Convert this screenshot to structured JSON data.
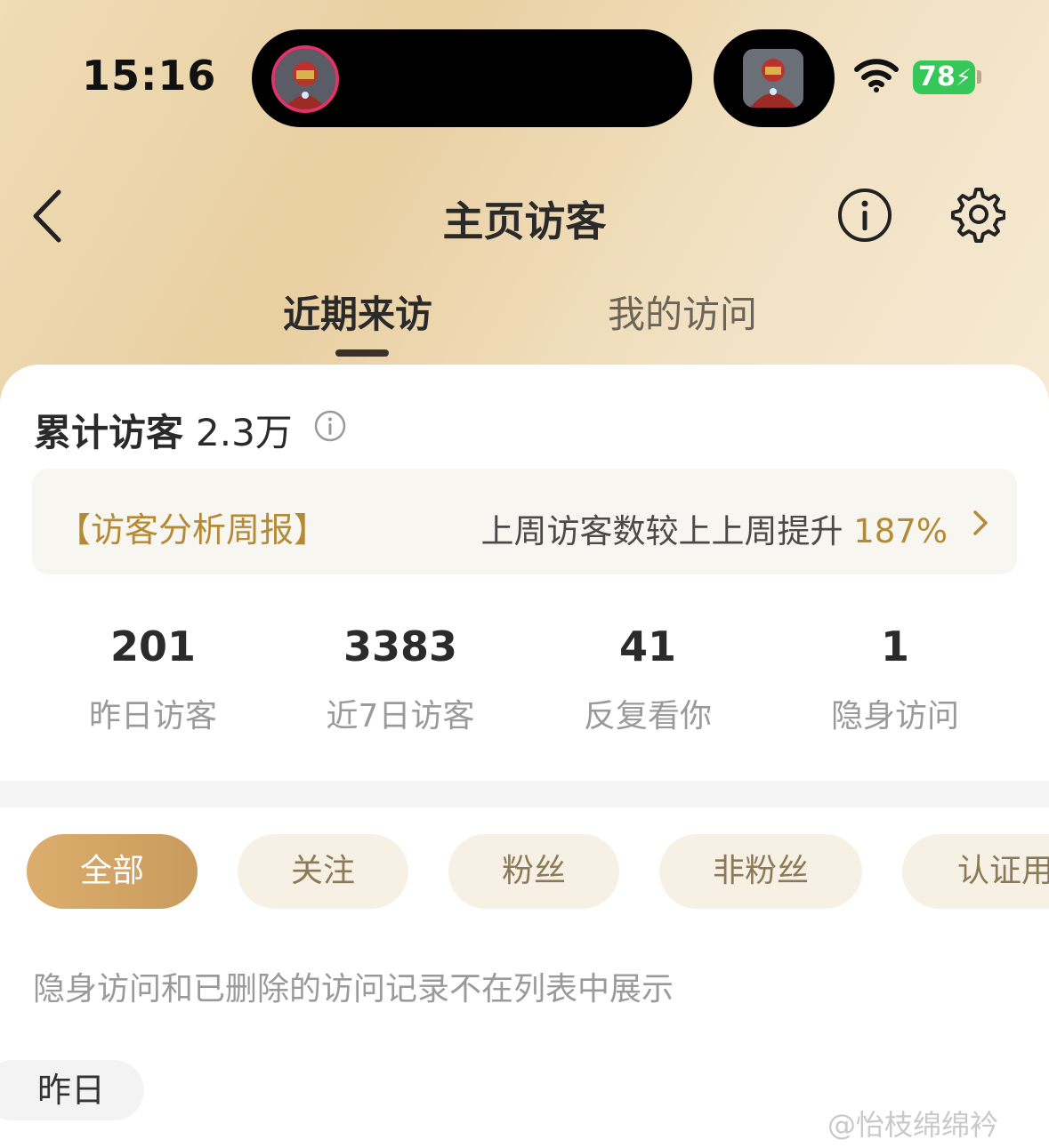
{
  "status_bar": {
    "time": "15:16",
    "battery": "78",
    "wifi_icon": "wifi-icon"
  },
  "nav": {
    "title": "主页访客",
    "back_icon": "chevron-left-icon",
    "info_icon": "info-icon",
    "settings_icon": "gear-icon"
  },
  "tabs": [
    {
      "label": "近期来访",
      "active": true
    },
    {
      "label": "我的访问",
      "active": false
    }
  ],
  "summary": {
    "label": "累计访客",
    "value": "2.3万"
  },
  "report": {
    "title": "【访客分析周报】",
    "text": "上周访客数较上上周提升",
    "percent": "187%"
  },
  "stats": [
    {
      "value": "201",
      "label": "昨日访客"
    },
    {
      "value": "3383",
      "label": "近7日访客"
    },
    {
      "value": "41",
      "label": "反复看你"
    },
    {
      "value": "1",
      "label": "隐身访问"
    }
  ],
  "filters": [
    {
      "label": "全部",
      "active": true
    },
    {
      "label": "关注",
      "active": false
    },
    {
      "label": "粉丝",
      "active": false
    },
    {
      "label": "非粉丝",
      "active": false
    },
    {
      "label": "认证用",
      "active": false
    }
  ],
  "notice": "隐身访问和已删除的访问记录不在列表中展示",
  "section_label": "昨日",
  "watermark": "@怡枝绵绵衿",
  "colors": {
    "accent_gold": "#b58a36",
    "chip_active": "#d6a866",
    "battery_green": "#36c759"
  }
}
